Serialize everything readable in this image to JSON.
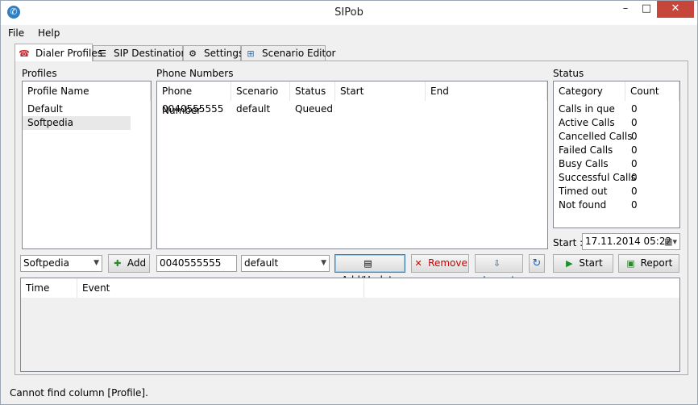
{
  "window": {
    "title": "SIPob"
  },
  "menu": [
    "File",
    "Help"
  ],
  "tabs": [
    {
      "label": "Dialer Profiles"
    },
    {
      "label": "SIP Destinations"
    },
    {
      "label": "Settings"
    },
    {
      "label": "Scenario Editor"
    }
  ],
  "profiles": {
    "label": "Profiles",
    "header": "Profile Name",
    "items": [
      "Default",
      "Softpedia"
    ],
    "selected_value": "Softpedia",
    "add_label": "Add"
  },
  "phones": {
    "label": "Phone Numbers",
    "headers": [
      "Phone Number",
      "Scenario",
      "Status",
      "Start",
      "End"
    ],
    "rows": [
      {
        "number": "0040555555",
        "scenario": "default",
        "status": "Queued",
        "start": "",
        "end": ""
      }
    ],
    "number_value": "0040555555",
    "scenario_value": "default",
    "add_update_label": "Add/Update",
    "remove_label": "Remove",
    "import_label": "Import"
  },
  "status": {
    "label": "Status",
    "headers": [
      "Category",
      "Count"
    ],
    "rows": [
      {
        "category": "Calls in que",
        "count": "0"
      },
      {
        "category": "Active Calls",
        "count": "0"
      },
      {
        "category": "Cancelled Calls",
        "count": "0"
      },
      {
        "category": "Failed Calls",
        "count": "0"
      },
      {
        "category": "Busy Calls",
        "count": "0"
      },
      {
        "category": "Successful Calls",
        "count": "0"
      },
      {
        "category": "Timed out",
        "count": "0"
      },
      {
        "category": "Not found",
        "count": "0"
      }
    ],
    "start_label": "Start :",
    "start_value": "17.11.2014 05:22",
    "start_button": "Start",
    "report_button": "Report"
  },
  "log": {
    "headers": [
      "Time",
      "Event"
    ]
  },
  "statusbar": {
    "text": "Cannot find column [Profile]."
  },
  "colors": {
    "remove": "#cc0000",
    "import": "#1f5fa8",
    "start": "#1a8f2a",
    "close_button": "#c7463c"
  }
}
